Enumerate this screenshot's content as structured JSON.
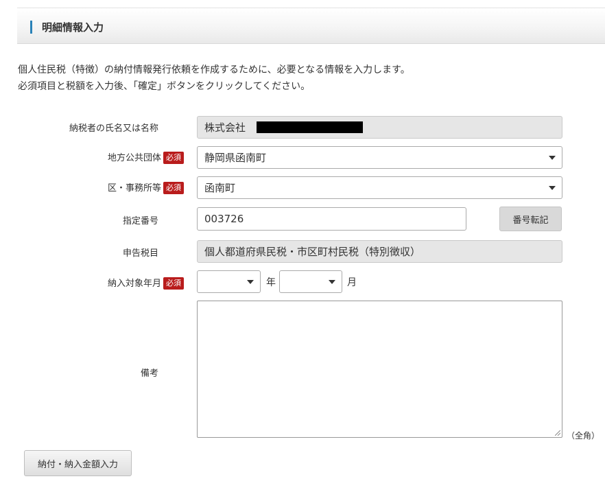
{
  "section": {
    "title": "明細情報入力"
  },
  "intro": {
    "line1": "個人住民税（特徴）の納付情報発行依頼を作成するために、必要となる情報を入力します。",
    "line2": "必須項目と税額を入力後、「確定」ボタンをクリックしてください。"
  },
  "required_badge": "必須",
  "form": {
    "taxpayer": {
      "label": "納税者の氏名又は名称",
      "value": "株式会社"
    },
    "municipality": {
      "label": "地方公共団体",
      "value": "静岡県函南町"
    },
    "office": {
      "label": "区・事務所等",
      "value": "函南町"
    },
    "designated_number": {
      "label": "指定番号",
      "value": "003726",
      "copy_button": "番号転記"
    },
    "tax_item": {
      "label": "申告税目",
      "value": "個人都道府県民税・市区町村民税（特別徴収）"
    },
    "period": {
      "label": "納入対象年月",
      "year_value": "",
      "year_unit": "年",
      "month_value": "",
      "month_unit": "月"
    },
    "remarks": {
      "label": "備考",
      "value": "",
      "note": "（全角）"
    }
  },
  "footer": {
    "amount_button": "納付・納入金額入力"
  }
}
